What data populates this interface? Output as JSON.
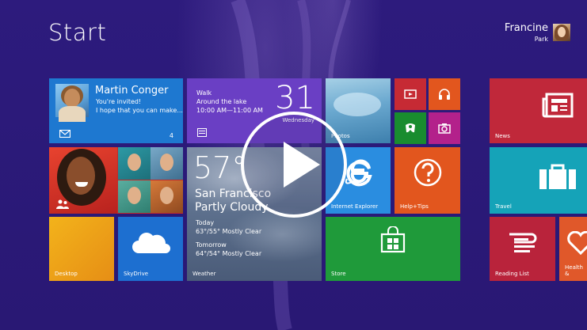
{
  "header": {
    "title": "Start",
    "user_first": "Francine",
    "user_last": "Park"
  },
  "tiles": {
    "mail": {
      "from": "Martin Conger",
      "subject": "You're invited!",
      "preview": "I hope that you can make...",
      "count": "4"
    },
    "calendar": {
      "event_title": "Walk",
      "event_location": "Around the lake",
      "event_time": "10:00 AM—11:00 AM",
      "day": "31",
      "weekday": "Wednesday"
    },
    "weather": {
      "temp": "57°",
      "city": "San Francisco",
      "condition": "Partly Cloudy",
      "today_label": "Today",
      "today_forecast": "63°/55° Mostly Clear",
      "tomorrow_label": "Tomorrow",
      "tomorrow_forecast": "64°/54° Mostly Clear",
      "label": "Weather"
    },
    "photos": {
      "label": "Photos"
    },
    "internet_explorer": {
      "label": "Internet Explorer"
    },
    "help": {
      "label": "Help+Tips"
    },
    "store": {
      "label": "Store"
    },
    "desktop": {
      "label": "Desktop"
    },
    "skydrive": {
      "label": "SkyDrive"
    },
    "news": {
      "label": "News"
    },
    "travel": {
      "label": "Travel"
    },
    "reading_list": {
      "label": "Reading List"
    },
    "health": {
      "label": "Health &"
    }
  },
  "icons": {
    "mail": "envelope-icon",
    "calendar": "calendar-icon",
    "people": "people-icon",
    "video": "video-icon",
    "music": "headphones-icon",
    "games": "gamepad-icon",
    "camera": "camera-icon",
    "ie": "internet-explorer-icon",
    "help": "question-icon",
    "store": "shopping-bag-icon",
    "skydrive": "cloud-icon",
    "news": "newspaper-icon",
    "travel": "suitcase-icon",
    "reading_list": "reading-list-icon",
    "play": "play-icon"
  },
  "colors": {
    "background": "#2b1a78",
    "mail": "#1e78d0",
    "calendar": "#6a3fc4",
    "store": "#1f9a3a",
    "help": "#e2561e",
    "news": "#c0283a",
    "travel": "#15a3b8"
  }
}
